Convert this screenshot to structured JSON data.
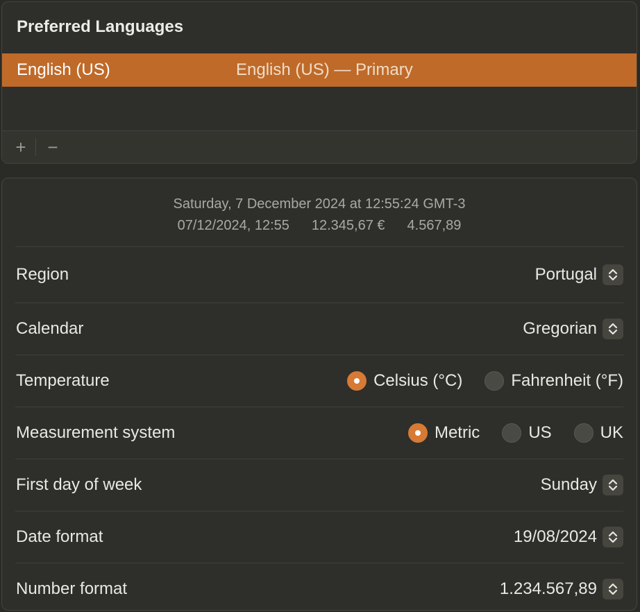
{
  "languages": {
    "title": "Preferred Languages",
    "items": [
      {
        "name": "English (US)",
        "description": "English (US) — Primary"
      }
    ],
    "add_label": "+",
    "remove_label": "−"
  },
  "preview": {
    "long_date": "Saturday, 7 December 2024 at 12:55:24 GMT-3",
    "short_date": "07/12/2024, 12:55",
    "currency": "12.345,67 €",
    "number": "4.567,89"
  },
  "settings": {
    "region": {
      "label": "Region",
      "value": "Portugal"
    },
    "calendar": {
      "label": "Calendar",
      "value": "Gregorian"
    },
    "temperature": {
      "label": "Temperature",
      "options": [
        "Celsius (°C)",
        "Fahrenheit (°F)"
      ],
      "selected": "Celsius (°C)"
    },
    "measurement": {
      "label": "Measurement system",
      "options": [
        "Metric",
        "US",
        "UK"
      ],
      "selected": "Metric"
    },
    "first_day": {
      "label": "First day of week",
      "value": "Sunday"
    },
    "date_format": {
      "label": "Date format",
      "value": "19/08/2024"
    },
    "number_format": {
      "label": "Number format",
      "value": "1.234.567,89"
    }
  },
  "colors": {
    "accent": "#d67a35",
    "selection": "#bf6a29",
    "background": "#2a2a27"
  },
  "icons": [
    "up-down-chevron-icon",
    "plus-icon",
    "minus-icon"
  ]
}
